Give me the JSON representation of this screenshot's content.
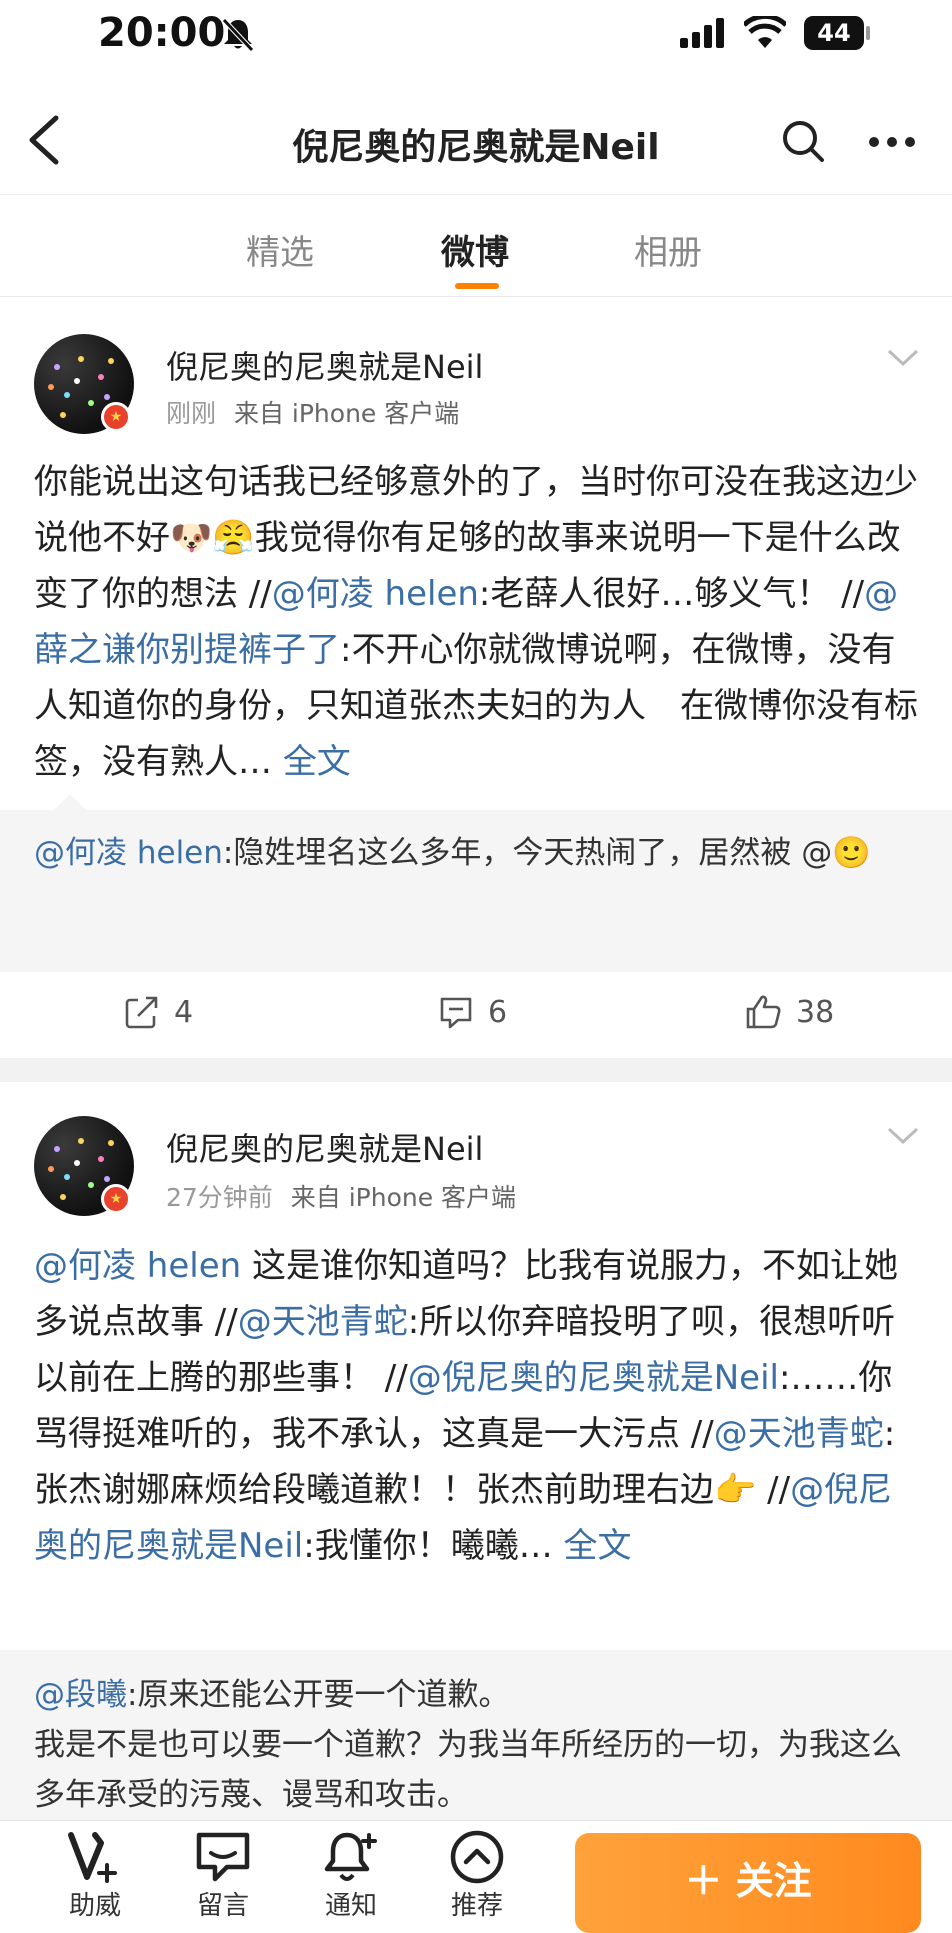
{
  "status_bar": {
    "time": "20:00",
    "battery": "44"
  },
  "nav": {
    "title": "倪尼奥的尼奥就是Neil"
  },
  "tabs": [
    "精选",
    "微博",
    "相册"
  ],
  "posts": [
    {
      "author": "倪尼奥的尼奥就是Neil",
      "time": "刚刚",
      "source": "来自 iPhone 客户端",
      "text_segments": [
        {
          "t": "你能说出这句话我已经够意外的了，当时你可没在我这边少说他不好",
          "link": false
        },
        {
          "t": "🐶😤",
          "link": false
        },
        {
          "t": "我觉得你有足够的故事来说明一下是什么改变了你的想法 //",
          "link": false
        },
        {
          "t": "@何凌 helen",
          "link": true
        },
        {
          "t": ":老薛人很好…够义气！ //",
          "link": false
        },
        {
          "t": "@薛之谦你别提裤子了",
          "link": true
        },
        {
          "t": ":不开心你就微博说啊，在微博，没有人知道你的身份，只知道张杰夫妇的为人　在微博你没有标签，没有熟人… ",
          "link": false
        },
        {
          "t": "全文",
          "link": true
        }
      ],
      "repost": [
        {
          "t": "@何凌 helen",
          "link": true
        },
        {
          "t": ":隐姓埋名这么多年，今天热闹了，居然被 @",
          "link": false
        },
        {
          "t": "🙂",
          "link": false
        }
      ],
      "reposts": "4",
      "comments": "6",
      "likes": "38"
    },
    {
      "author": "倪尼奥的尼奥就是Neil",
      "time": "27分钟前",
      "source": "来自 iPhone 客户端",
      "text_segments": [
        {
          "t": "@何凌 helen",
          "link": true
        },
        {
          "t": " 这是谁你知道吗？比我有说服力，不如让她多说点故事 //",
          "link": false
        },
        {
          "t": "@天池青蛇",
          "link": true
        },
        {
          "t": ":所以你弃暗投明了呗，很想听听以前在上腾的那些事！ //",
          "link": false
        },
        {
          "t": "@倪尼奥的尼奥就是Neil",
          "link": true
        },
        {
          "t": ":……你骂得挺难听的，我不承认，这真是一大污点 //",
          "link": false
        },
        {
          "t": "@天池青蛇",
          "link": true
        },
        {
          "t": ":张杰谢娜麻烦给段曦道歉！！张杰前助理右边",
          "link": false
        },
        {
          "t": "👉",
          "link": false
        },
        {
          "t": " //",
          "link": false
        },
        {
          "t": "@倪尼奥的尼奥就是Neil",
          "link": true
        },
        {
          "t": ":我懂你！曦曦… ",
          "link": false
        },
        {
          "t": "全文",
          "link": true
        }
      ],
      "repost": [
        {
          "t": "@段曦",
          "link": true
        },
        {
          "t": ":原来还能公开要一个道歉。\n我是不是也可以要一个道歉？为我当年所经历的一切，为我这么多年承受的污蔑、谩骂和攻击。",
          "link": false
        }
      ]
    }
  ],
  "bottom_bar": {
    "items": [
      "助威",
      "留言",
      "通知",
      "推荐"
    ],
    "follow": "＋ 关注"
  },
  "colors": {
    "accent": "#ff8200",
    "link": "#3a6ea5",
    "follow_btn": "#ff9a2e"
  }
}
